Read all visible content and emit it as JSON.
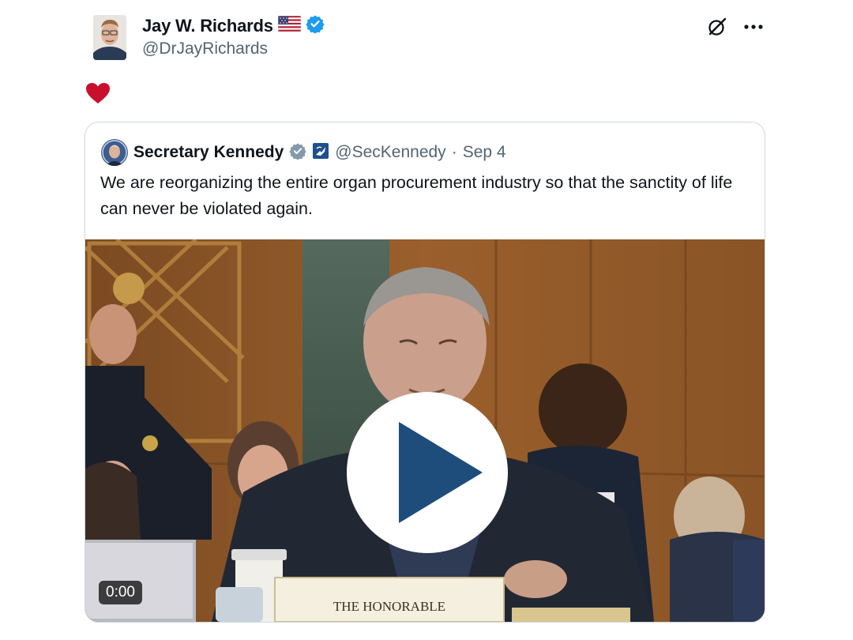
{
  "author": {
    "name": "Jay W. Richards",
    "handle": "@DrJayRichards",
    "flag_icon": "us-flag-icon",
    "verified_icon": "verified-badge-icon"
  },
  "actions": {
    "grok_icon": "grok-icon",
    "more_icon": "more-icon"
  },
  "post_reaction_icon": "heart-icon",
  "quoted": {
    "name": "Secretary Kennedy",
    "handle": "@SecKennedy",
    "separator": "·",
    "date": "Sep 4",
    "text": "We are reorganizing the entire organ procurement industry so that the sanctity of life can never be violated again.",
    "badges": [
      "gray-verified-badge-icon",
      "government-affiliation-icon"
    ]
  },
  "video": {
    "timestamp": "0:00",
    "nameplate": "THE HONORABLE"
  },
  "colors": {
    "verified_blue": "#1d9bf0",
    "gov_gray": "#829aab",
    "heart_red": "#c8102e",
    "play_triangle": "#1e4d7b",
    "secondary_text": "#536471"
  }
}
